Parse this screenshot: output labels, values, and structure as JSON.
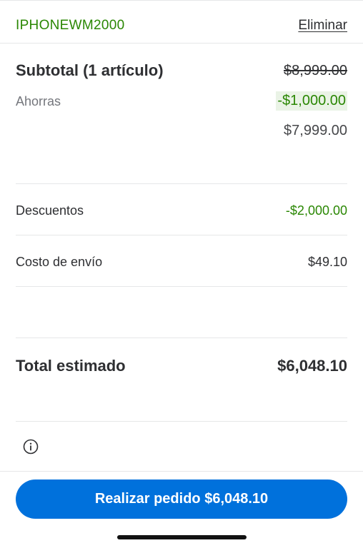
{
  "promo": {
    "code": "IPHONEWM2000",
    "remove_label": "Eliminar"
  },
  "summary": {
    "subtotal_label": "Subtotal (1 artículo)",
    "subtotal_original": "$8,999.00",
    "savings_label": "Ahorras",
    "savings_amount": "-$1,000.00",
    "subtotal_after_savings": "$7,999.00",
    "discounts_label": "Descuentos",
    "discounts_amount": "-$2,000.00",
    "shipping_label": "Costo de envío",
    "shipping_amount": "$49.10",
    "total_label": "Total estimado",
    "total_amount": "$6,048.10"
  },
  "footer": {
    "info_icon": "info-circle-icon",
    "cta_label": "Realizar pedido $6,048.10"
  },
  "colors": {
    "green": "#2a8703",
    "green_bg": "#eaf3e6",
    "primary_blue": "#0071dc",
    "text": "#2e2f32",
    "muted": "#74767c",
    "divider": "#e6e7e8"
  }
}
